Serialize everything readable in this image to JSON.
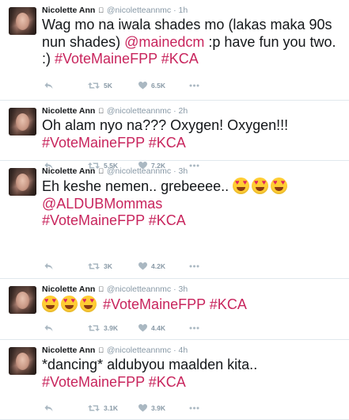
{
  "author": {
    "name": "Nicolette Ann",
    "handle": "@nicoletteannmc",
    "separator": "·"
  },
  "icons": {
    "reply": "reply-icon",
    "retweet": "retweet-icon",
    "like": "heart-icon",
    "more": "more-icon",
    "verified_device": "apple-icon"
  },
  "colors": {
    "hashtag": "#c8255d",
    "meta": "#8899a6",
    "text": "#14171a",
    "divider": "#e1e8ed"
  },
  "tweets": [
    {
      "time": "1h",
      "parts": [
        {
          "t": "Wag mo na iwala shades mo (lakas maka 90s nun shades) "
        },
        {
          "t": "@mainedcm",
          "k": "link"
        },
        {
          "t": " :p have fun you two. :) "
        },
        {
          "t": "#VoteMaineFPP",
          "k": "hash"
        },
        {
          "t": " "
        },
        {
          "t": "#KCA",
          "k": "hash"
        }
      ],
      "retweets": "5K",
      "likes": "6.5K"
    },
    {
      "time": "2h",
      "parts": [
        {
          "t": "Oh alam nyo na??? Oxygen! Oxygen!!! "
        },
        {
          "t": "#VoteMaineFPP",
          "k": "hash"
        },
        {
          "t": " "
        },
        {
          "t": "#KCA",
          "k": "hash"
        }
      ],
      "retweets": "5.5K",
      "likes": "7.2K"
    },
    {
      "time": "3h",
      "parts": [
        {
          "t": "Eh keshe nemen.. grebeeee.. "
        },
        {
          "k": "emoji"
        },
        {
          "k": "emoji"
        },
        {
          "k": "emoji"
        },
        {
          "k": "br"
        },
        {
          "t": "@ALDUBMommas",
          "k": "link"
        },
        {
          "k": "br"
        },
        {
          "t": "#VoteMaineFPP",
          "k": "hash"
        },
        {
          "t": " "
        },
        {
          "t": "#KCA",
          "k": "hash"
        }
      ],
      "retweets": "3K",
      "likes": "4.2K"
    },
    {
      "time": "3h",
      "parts": [
        {
          "k": "emoji"
        },
        {
          "k": "emoji"
        },
        {
          "k": "emoji"
        },
        {
          "t": " "
        },
        {
          "t": "#VoteMaineFPP",
          "k": "hash"
        },
        {
          "t": " "
        },
        {
          "t": "#KCA",
          "k": "hash"
        }
      ],
      "retweets": "3.9K",
      "likes": "4.4K"
    },
    {
      "time": "4h",
      "parts": [
        {
          "t": "*dancing* aldubyou maalden kita.. "
        },
        {
          "k": "br"
        },
        {
          "t": "#VoteMaineFPP",
          "k": "hash"
        },
        {
          "t": " "
        },
        {
          "t": "#KCA",
          "k": "hash"
        }
      ],
      "retweets": "3.1K",
      "likes": "3.9K"
    }
  ]
}
